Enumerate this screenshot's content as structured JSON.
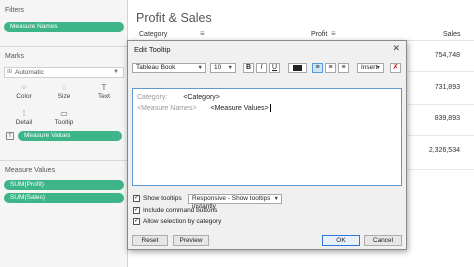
{
  "left_panel": {
    "filters_title": "Filters",
    "filters_pill": "Measure Names",
    "marks_title": "Marks",
    "mark_type": "Automatic",
    "cards": [
      {
        "label": "Color",
        "icon": "color-palette-icon"
      },
      {
        "label": "Size",
        "icon": "size-icon"
      },
      {
        "label": "Text",
        "icon": "text-icon"
      },
      {
        "label": "Detail",
        "icon": "detail-icon"
      },
      {
        "label": "Tooltip",
        "icon": "tooltip-icon"
      }
    ],
    "measure_values_pill": "Measure Values",
    "measure_values_title": "Measure Values",
    "measure_pills": [
      "SUM(Profit)",
      "SUM(Sales)"
    ]
  },
  "sheet": {
    "title": "Profit & Sales",
    "col_category": "Category",
    "col_profit": "Profit",
    "col_sales": "Sales",
    "values": [
      "754,748",
      "731,893",
      "839,893",
      "2,326,534"
    ]
  },
  "dialog": {
    "title": "Edit Tooltip",
    "font_name": "Tableau Book",
    "font_size": "10",
    "bold": "B",
    "italic": "I",
    "underline": "U",
    "insert_label": "Insert",
    "editor_line1_static": "Category:",
    "editor_line1_field": "<Category>",
    "editor_line2_field1": "<Measure Names>",
    "editor_line2_field2": "<Measure Values>",
    "show_tooltips_label": "Show tooltips",
    "tooltip_mode": "Responsive - Show tooltips instantly",
    "include_command_buttons": "Include command buttons",
    "allow_selection": "Allow selection by category",
    "reset": "Reset",
    "preview": "Preview",
    "ok": "OK",
    "cancel": "Cancel",
    "colors": {
      "accent": "#3eb489",
      "focus": "#2b78d6"
    }
  }
}
